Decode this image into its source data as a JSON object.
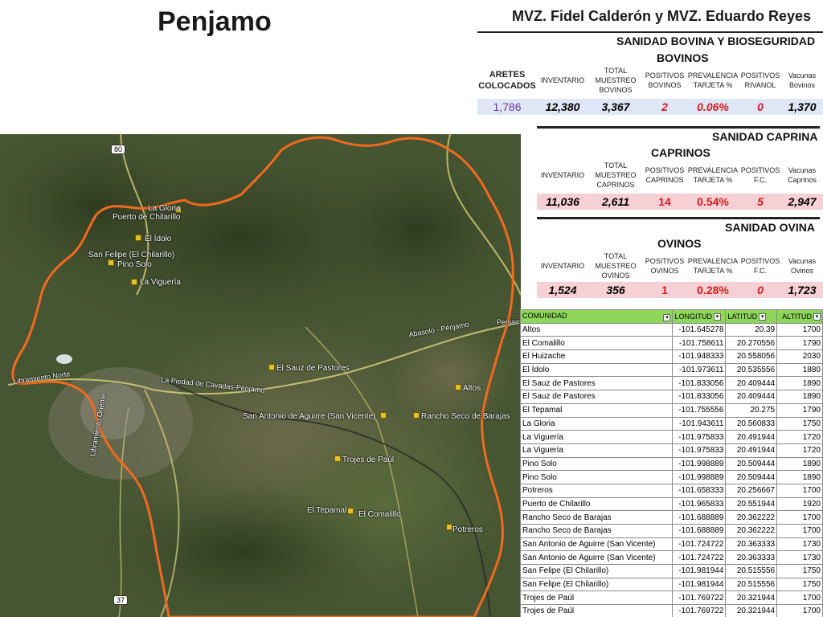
{
  "header": {
    "title": "Penjamo",
    "authors": "MVZ. Fidel Calderón y MVZ. Eduardo Reyes"
  },
  "bovina": {
    "section_title": "SANIDAD BOVINA Y BIOSEGURIDAD",
    "subtitle": "BOVINOS",
    "headers": [
      "ARETES COLOCADOS",
      "INVENTARIO",
      "TOTAL MUESTREO BOVINOS",
      "POSITIVOS BOVINOS",
      "PREVALENCIA TARJETA %",
      "POSITIVOS RIVANOL",
      "Vacunas Bovinos"
    ],
    "values": [
      "1,786",
      "12,380",
      "3,367",
      "2",
      "0.06%",
      "0",
      "1,370"
    ]
  },
  "caprina": {
    "section_title": "SANIDAD CAPRINA",
    "subtitle": "CAPRINOS",
    "headers": [
      "INVENTARIO",
      "TOTAL MUESTREO CAPRINOS",
      "POSITIVOS CAPRINOS",
      "PREVALENCIA TARJETA %",
      "POSITIVOS F.C.",
      "Vacunas Caprinos"
    ],
    "values": [
      "11,036",
      "2,611",
      "14",
      "0.54%",
      "5",
      "2,947"
    ]
  },
  "ovina": {
    "section_title": "SANIDAD OVINA",
    "subtitle": "OVINOS",
    "headers": [
      "INVENTARIO",
      "TOTAL MUESTREO OVINOS",
      "POSITIVOS OVINOS",
      "PREVALENCIA TARJETA %",
      "POSITIVOS F.C.",
      "Vacunas Ovinos"
    ],
    "values": [
      "1,524",
      "356",
      "1",
      "0.28%",
      "0",
      "1,723"
    ]
  },
  "colors": {
    "boundary": "#f26a1f",
    "header_green": "#8dd65a",
    "value_band_blue": "#dfe6f5",
    "value_band_pink": "#f6d0d4",
    "red_text": "#d41c1c"
  },
  "map": {
    "labels": {
      "la_gloria": "La Gloria",
      "puerto_chilarillo": "Puerto de Chilarillo",
      "el_idolo": "El Ídolo",
      "san_felipe": "San Felipe (El Chilarillo)",
      "pino_solo": "Pino Solo",
      "la_vigueria": "La Viguería",
      "el_sauz": "El Sauz de Pastores",
      "altos": "Altos",
      "san_antonio": "San Antonio de Aguirre (San Vicente)",
      "rancho_seco": "Rancho Seco de Barajas",
      "trojes": "Trojes de Paúl",
      "el_tepamal": "El Tepamal",
      "el_comalillo": "El Comalillo",
      "potreros": "Potreros",
      "libramiento_norte": "Libramiento Norte",
      "libramiento_oriente": "Libramiento Oriente",
      "piedad_road": "La Piedad de Cavadas-Pénjamo",
      "abasolo_road": "Abasolo - Pénjamo",
      "penjam_edge": "Penjam",
      "hwy80": "80",
      "hwy37": "37"
    }
  },
  "communities": {
    "columns": [
      "COMUNIDAD",
      "LONGITUD",
      "LATITUD",
      "ALTITUD"
    ],
    "rows": [
      [
        "Altos",
        "-101.645278",
        "20.39",
        "1700"
      ],
      [
        "El Comalillo",
        "-101.758611",
        "20.270556",
        "1790"
      ],
      [
        "El Huizache",
        "-101.948333",
        "20.558056",
        "2030"
      ],
      [
        "El Ídolo",
        "-101.973611",
        "20.535556",
        "1880"
      ],
      [
        "El Sauz de Pastores",
        "-101.833056",
        "20.409444",
        "1890"
      ],
      [
        "El Sauz de Pastores",
        "-101.833056",
        "20.409444",
        "1890"
      ],
      [
        "El Tepamal",
        "-101.755556",
        "20.275",
        "1790"
      ],
      [
        "La Gloria",
        "-101.943611",
        "20.560833",
        "1750"
      ],
      [
        "La Viguería",
        "-101.975833",
        "20.491944",
        "1720"
      ],
      [
        "La Viguería",
        "-101.975833",
        "20.491944",
        "1720"
      ],
      [
        "Pino Solo",
        "-101.998889",
        "20.509444",
        "1890"
      ],
      [
        "Pino Solo",
        "-101.998889",
        "20.509444",
        "1890"
      ],
      [
        "Potreros",
        "-101.658333",
        "20.256667",
        "1700"
      ],
      [
        "Puerto de Chilarillo",
        "-101.965833",
        "20.551944",
        "1920"
      ],
      [
        "Rancho Seco de Barajas",
        "-101.688889",
        "20.362222",
        "1700"
      ],
      [
        "Rancho Seco de Barajas",
        "-101.688889",
        "20.362222",
        "1700"
      ],
      [
        "San Antonio de Aguirre (San Vicente)",
        "-101.724722",
        "20.363333",
        "1730"
      ],
      [
        "San Antonio de Aguirre (San Vicente)",
        "-101.724722",
        "20.363333",
        "1730"
      ],
      [
        "San Felipe (El Chilarillo)",
        "-101.981944",
        "20.515556",
        "1750"
      ],
      [
        "San Felipe (El Chilarillo)",
        "-101.981944",
        "20.515556",
        "1750"
      ],
      [
        "Trojes de Paúl",
        "-101.769722",
        "20.321944",
        "1700"
      ],
      [
        "Trojes de Paúl",
        "-101.769722",
        "20.321944",
        "1700"
      ]
    ]
  }
}
